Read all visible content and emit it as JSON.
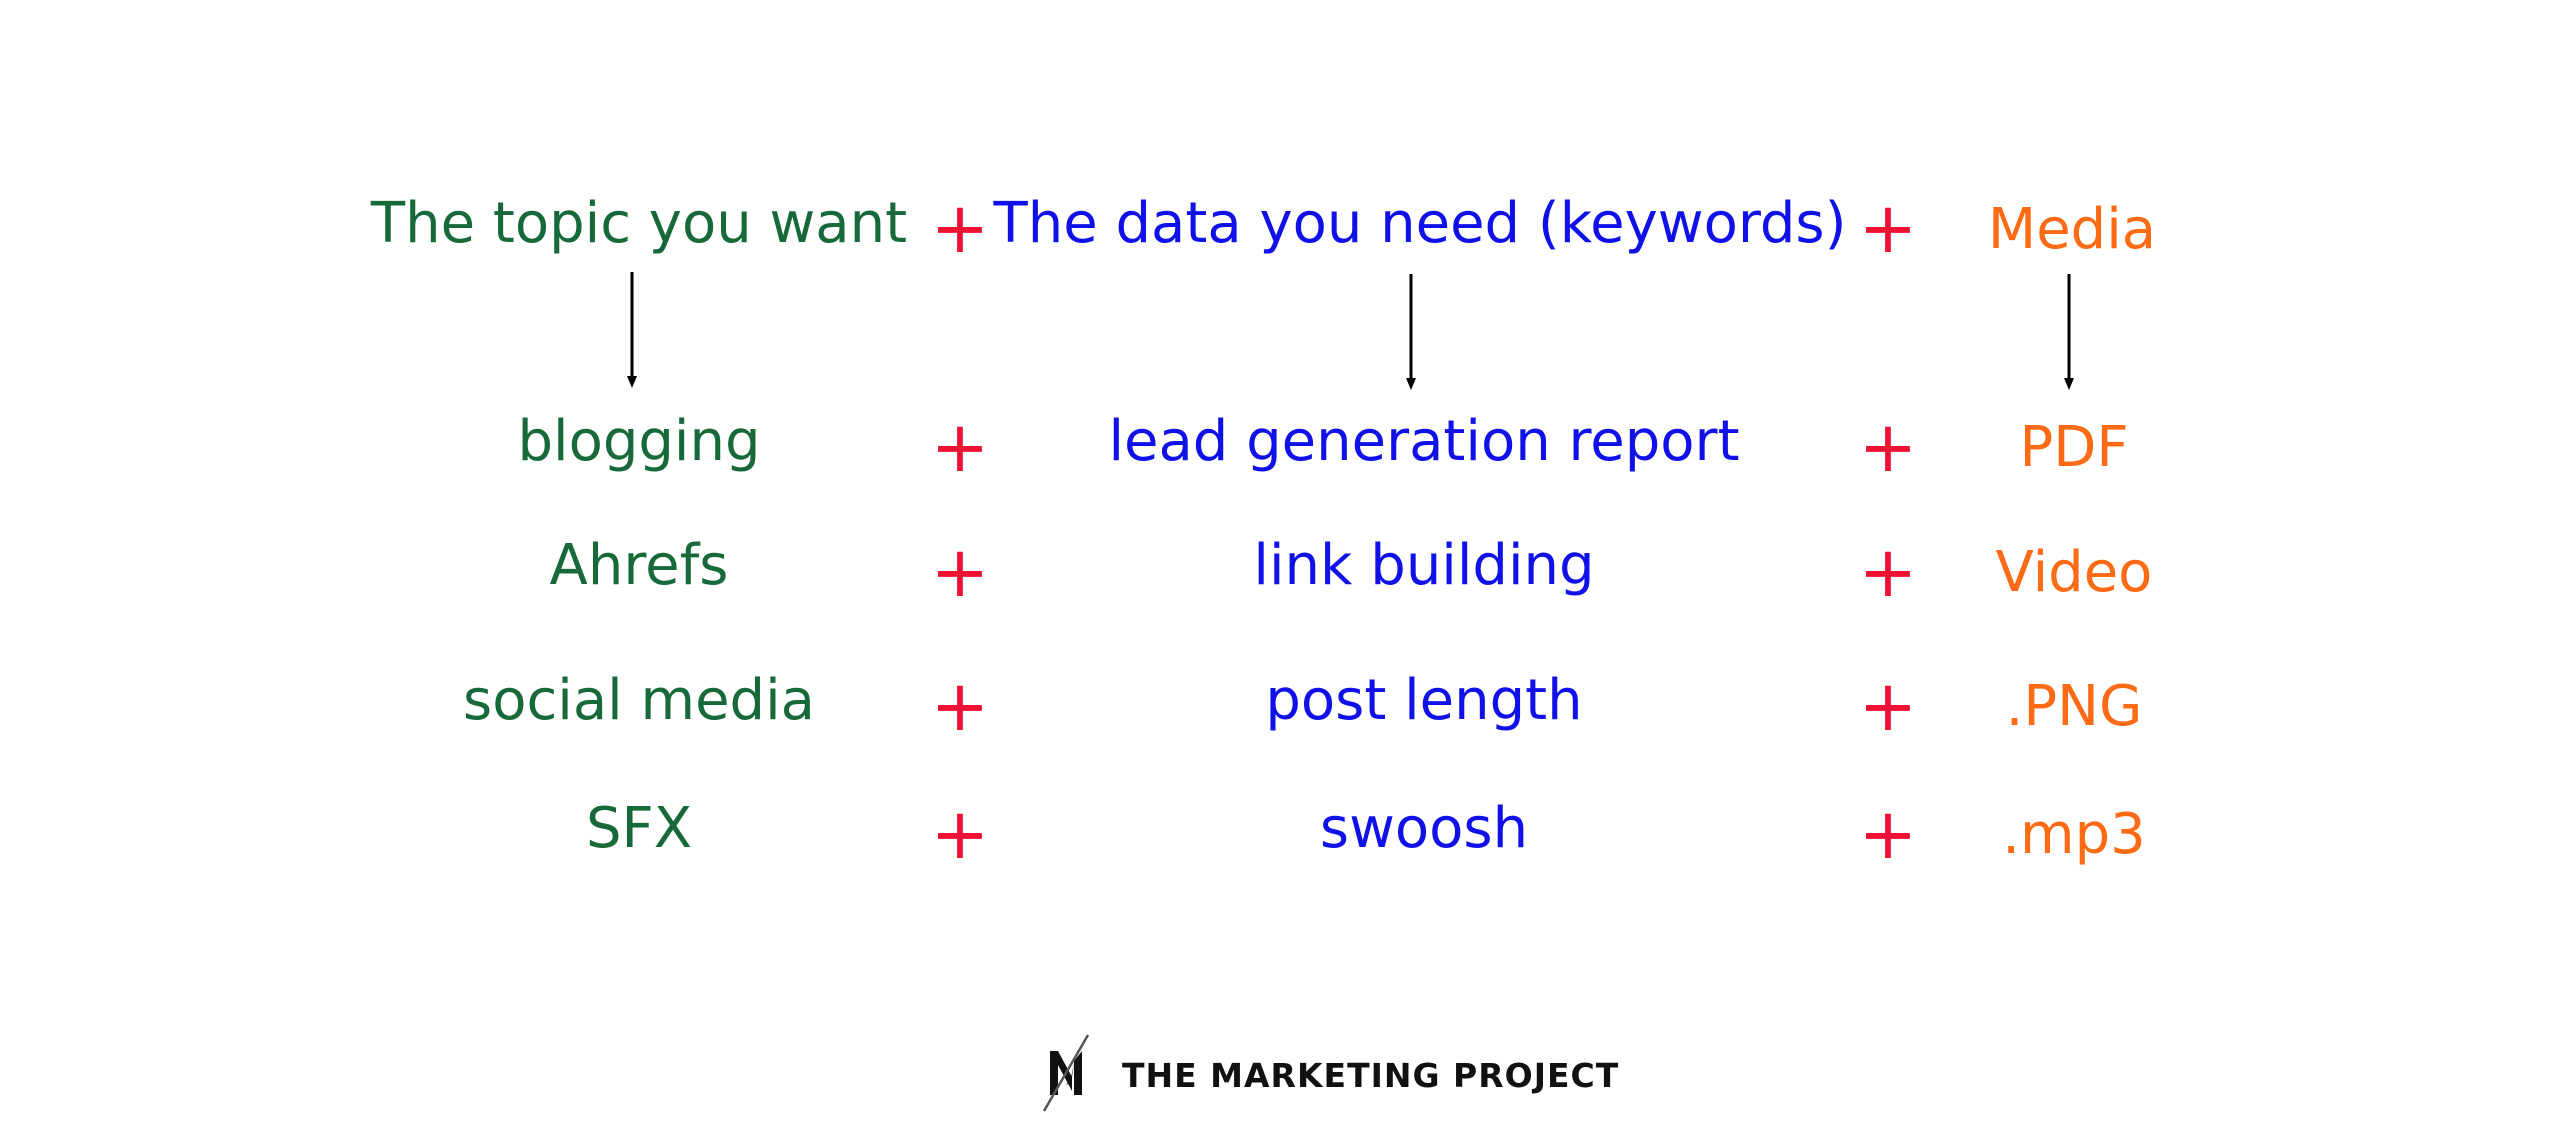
{
  "headers": {
    "topic": "The topic you want",
    "data": "The data you need (keywords)",
    "media": "Media"
  },
  "operator": "+",
  "rows": [
    {
      "topic": "blogging",
      "data": "lead generation report",
      "media": "PDF"
    },
    {
      "topic": "Ahrefs",
      "data": "link building",
      "media": "Video"
    },
    {
      "topic": "social media",
      "data": "post length",
      "media": ".PNG"
    },
    {
      "topic": "SFX",
      "data": "swoosh",
      "media": ".mp3"
    }
  ],
  "colors": {
    "topic": "#17693a",
    "data": "#1010e8",
    "media": "#ff6a14",
    "operator": "#ee1133"
  },
  "brand": {
    "name": "THE MARKETING PROJECT",
    "logo_icon": "m-slash-logo-icon"
  }
}
